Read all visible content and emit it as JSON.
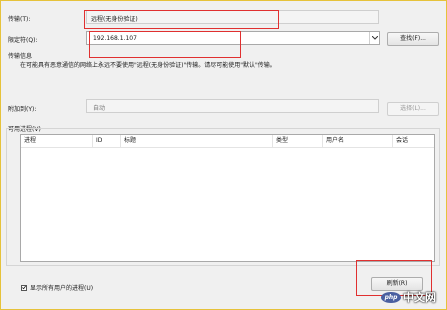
{
  "transport": {
    "label": "传输(T):",
    "value": "远程(无身份验证)"
  },
  "qualifier": {
    "label": "限定符(Q):",
    "value": "192.168.1.107",
    "find_button": "查找(F)..."
  },
  "transport_info": {
    "heading": "传输信息",
    "text": "在可能具有恶意通信的网络上永远不要使用\"远程(无身份验证)\"传输。请尽可能使用\"默认\"传输。"
  },
  "attach_to": {
    "label": "附加到(Y):",
    "value": "自动",
    "select_button": "选择(L)..."
  },
  "processes": {
    "heading": "可用进程(V)",
    "columns": [
      "进程",
      "ID",
      "标题",
      "类型",
      "用户名",
      "会话"
    ],
    "rows": []
  },
  "show_all_users": {
    "label": "显示所有用户的进程(U)",
    "checked": true
  },
  "bottom_button": "刷新(R)",
  "watermark": {
    "logo": "php",
    "site": "中文网"
  }
}
